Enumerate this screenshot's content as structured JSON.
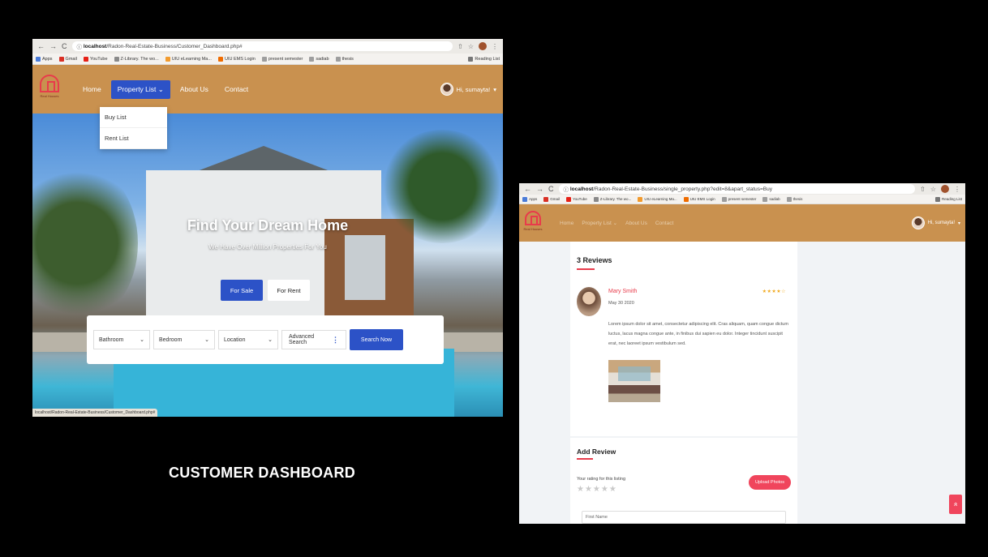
{
  "caption": "CUSTOMER DASHBOARD",
  "left": {
    "browser": {
      "url_host": "localhost",
      "url_path": "/Radon-Real-Estate-Business/Customer_Dashboard.php#",
      "bookmarks": [
        "Apps",
        "Gmail",
        "YouTube",
        "Z-Library. The wo...",
        "UIU eLearning Ma...",
        "UIU EMS Login",
        "present semester",
        "sadiab",
        "thesis"
      ],
      "reading_list": "Reading List",
      "status_url": "localhost/Radon-Real-Estate-Business/Customer_Dashboard.php#"
    },
    "nav": {
      "logo_text": "Real Houses",
      "links": [
        "Home",
        "Property List",
        "About Us",
        "Contact"
      ],
      "user": "Hi, sumayta!"
    },
    "dropdown": [
      "Buy List",
      "Rent List"
    ],
    "hero": {
      "title": "Find Your Dream Home",
      "subtitle": "We Have Over Million Properties For You",
      "btn_sale": "For Sale",
      "btn_rent": "For Rent"
    },
    "search": {
      "bathroom": "Bathroom",
      "bedroom": "Bedroom",
      "location": "Location",
      "advanced": "Advanced Search",
      "button": "Search Now"
    }
  },
  "right": {
    "browser": {
      "url_host": "localhost",
      "url_path": "/Radon-Real-Estate-Business/single_property.php?edit=8&apart_status=Buy",
      "bookmarks": [
        "Apps",
        "Gmail",
        "YouTube",
        "Z-Library. The wo...",
        "UIU eLearning Ma...",
        "UIU EMS Login",
        "present semester",
        "sadiab",
        "thesis"
      ],
      "reading_list": "Reading List"
    },
    "nav": {
      "logo_text": "Real Houses",
      "links": [
        "Home",
        "Property List",
        "About Us",
        "Contact"
      ],
      "user": "Hi, sumayta!"
    },
    "reviews": {
      "title": "3 Reviews",
      "name": "Mary Smith",
      "date": "May 30 2020",
      "stars": "★★★★☆",
      "body": "Lorem ipsum dolor sit amet, consectetur adipiscing elit. Cras aliquam, quam congue dictum luctus, lacus magna congue ante, in finibus dui sapien eu dolor. Integer tincidunt suscipit erat, nec laoreet ipsum vestibulum sed."
    },
    "add_review": {
      "title": "Add Review",
      "rating_label": "Your rating for this listing",
      "stars": "★★★★★",
      "upload_button": "Upload Photos",
      "first_name_placeholder": "First Name"
    },
    "scroll_top": "»"
  }
}
